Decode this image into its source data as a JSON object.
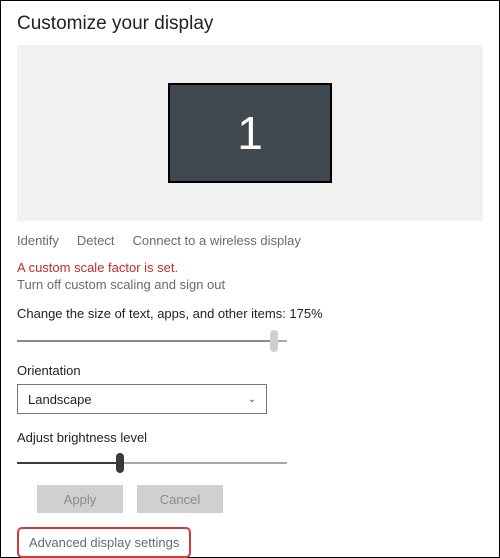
{
  "title": "Customize your display",
  "monitor_number": "1",
  "links": {
    "identify": "Identify",
    "detect": "Detect",
    "wireless": "Connect to a wireless display"
  },
  "warning": "A custom scale factor is set.",
  "turn_off_link": "Turn off custom scaling and sign out",
  "scale_label": "Change the size of text, apps, and other items: 175%",
  "scale_slider": {
    "percent": 95
  },
  "orientation": {
    "label": "Orientation",
    "value": "Landscape"
  },
  "brightness": {
    "label": "Adjust brightness level",
    "percent": 38
  },
  "buttons": {
    "apply": "Apply",
    "cancel": "Cancel"
  },
  "advanced": "Advanced display settings"
}
